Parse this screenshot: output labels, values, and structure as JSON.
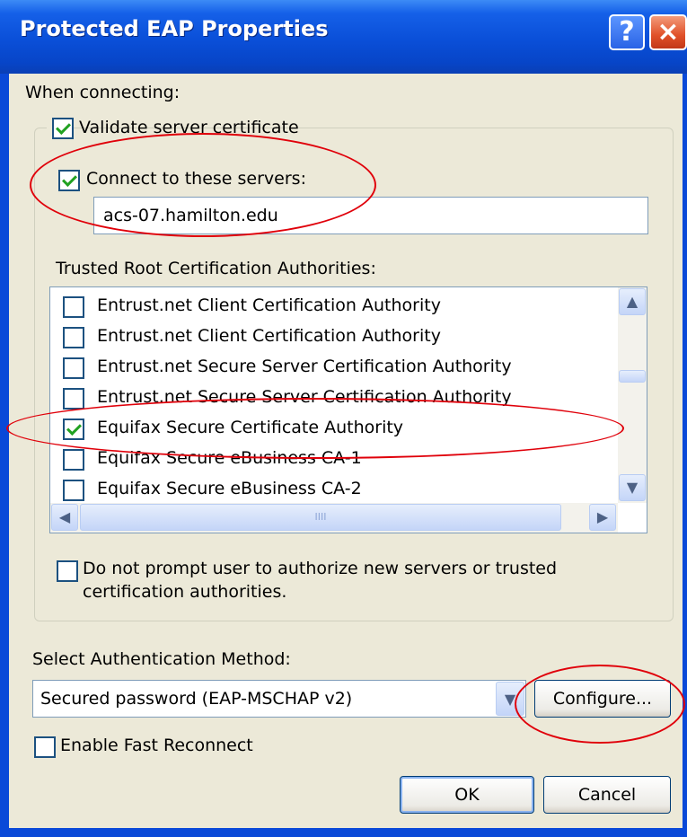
{
  "window": {
    "title": "Protected EAP Properties",
    "help_glyph": "?",
    "close_glyph": "×"
  },
  "when_connecting_label": "When connecting:",
  "validate_server_cert": {
    "label": "Validate server certificate",
    "checked": true
  },
  "connect_to_servers": {
    "label": "Connect to these servers:",
    "checked": true,
    "value": "acs-07.hamilton.edu"
  },
  "trusted_root_label": "Trusted Root Certification Authorities:",
  "cert_list": {
    "items": [
      {
        "label": "Entrust.net Client Certification Authority",
        "checked": false
      },
      {
        "label": "Entrust.net Client Certification Authority",
        "checked": false
      },
      {
        "label": "Entrust.net Secure Server Certification Authority",
        "checked": false
      },
      {
        "label": "Entrust.net Secure Server Certification Authority",
        "checked": false
      },
      {
        "label": "Equifax Secure Certificate Authority",
        "checked": true
      },
      {
        "label": "Equifax Secure eBusiness CA-1",
        "checked": false
      },
      {
        "label": "Equifax Secure eBusiness CA-2",
        "checked": false
      }
    ],
    "scroll_up_glyph": "▲",
    "scroll_down_glyph": "▼",
    "scroll_left_glyph": "◀",
    "scroll_right_glyph": "▶",
    "hthumb_grip": "IIII"
  },
  "do_not_prompt": {
    "label_line1": "Do not prompt user to authorize new servers or trusted",
    "label_line2": "certification authorities.",
    "checked": false
  },
  "auth_method_label": "Select Authentication Method:",
  "auth_method": {
    "selected": "Secured password (EAP-MSCHAP v2)",
    "arrow_glyph": "▼"
  },
  "configure_button": "Configure...",
  "fast_reconnect": {
    "label": "Enable Fast Reconnect",
    "checked": false
  },
  "ok_button": "OK",
  "cancel_button": "Cancel",
  "colors": {
    "titlebar": "#0a49d8",
    "dialog_bg": "#ece9d8",
    "annotation": "#e0000a"
  }
}
